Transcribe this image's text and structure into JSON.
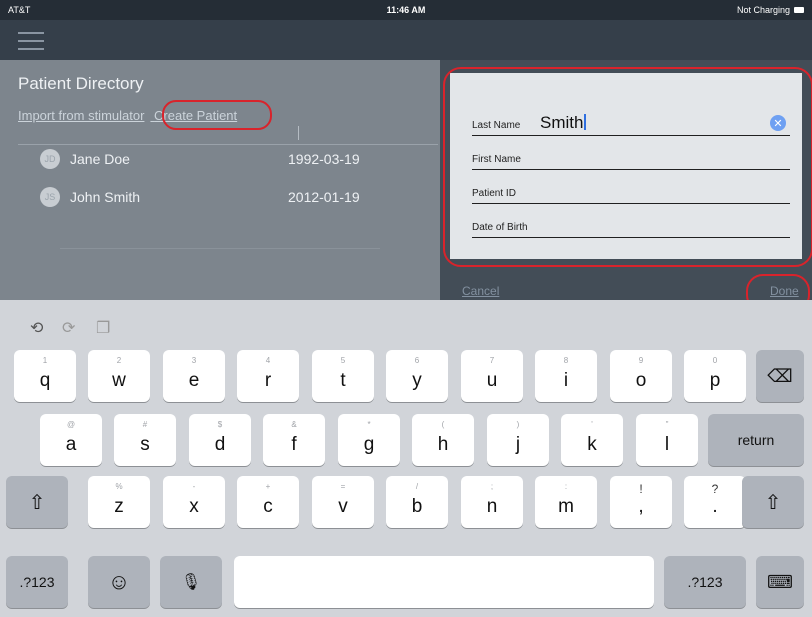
{
  "status_bar": {
    "carrier": "AT&T",
    "time": "11:46 AM",
    "battery_status": "Not Charging"
  },
  "header": {
    "menu_icon": "hamburger-icon"
  },
  "directory": {
    "title": "Patient Directory",
    "import_link": "Import from stimulator",
    "create_link": "Create Patient",
    "patients": [
      {
        "initials": "JD",
        "name": "Jane Doe",
        "dob": "1992-03-19"
      },
      {
        "initials": "JS",
        "name": "John Smith",
        "dob": "2012-01-19"
      }
    ]
  },
  "form": {
    "last_name": {
      "label": "Last Name",
      "value": "Smith"
    },
    "first_name": {
      "label": "First Name",
      "value": ""
    },
    "patient_id": {
      "label": "Patient ID",
      "value": ""
    },
    "dob": {
      "label": "Date of Birth",
      "value": ""
    },
    "cancel": "Cancel",
    "done": "Done"
  },
  "keyboard": {
    "assist_icons": [
      "undo-icon",
      "redo-icon",
      "paste-icon"
    ],
    "row1": [
      {
        "hint": "1",
        "key": "q"
      },
      {
        "hint": "2",
        "key": "w"
      },
      {
        "hint": "3",
        "key": "e"
      },
      {
        "hint": "4",
        "key": "r"
      },
      {
        "hint": "5",
        "key": "t"
      },
      {
        "hint": "6",
        "key": "y"
      },
      {
        "hint": "7",
        "key": "u"
      },
      {
        "hint": "8",
        "key": "i"
      },
      {
        "hint": "9",
        "key": "o"
      },
      {
        "hint": "0",
        "key": "p"
      }
    ],
    "row2": [
      {
        "hint": "@",
        "key": "a"
      },
      {
        "hint": "#",
        "key": "s"
      },
      {
        "hint": "$",
        "key": "d"
      },
      {
        "hint": "&",
        "key": "f"
      },
      {
        "hint": "*",
        "key": "g"
      },
      {
        "hint": "(",
        "key": "h"
      },
      {
        "hint": ")",
        "key": "j"
      },
      {
        "hint": "'",
        "key": "k"
      },
      {
        "hint": "\"",
        "key": "l"
      }
    ],
    "row3": [
      {
        "hint": "%",
        "key": "z"
      },
      {
        "hint": "-",
        "key": "x"
      },
      {
        "hint": "+",
        "key": "c"
      },
      {
        "hint": "=",
        "key": "v"
      },
      {
        "hint": "/",
        "key": "b"
      },
      {
        "hint": ";",
        "key": "n"
      },
      {
        "hint": ":",
        "key": "m"
      },
      {
        "hint": "!",
        "key": ","
      },
      {
        "hint": "?",
        "key": "."
      }
    ],
    "return_label": "return",
    "numbers_label": ".?123",
    "backspace_symbol": "⌫",
    "shift_symbol": "⇧",
    "emoji_symbol": "☺",
    "mic_symbol": "🎙",
    "hide_symbol": "⌨"
  }
}
